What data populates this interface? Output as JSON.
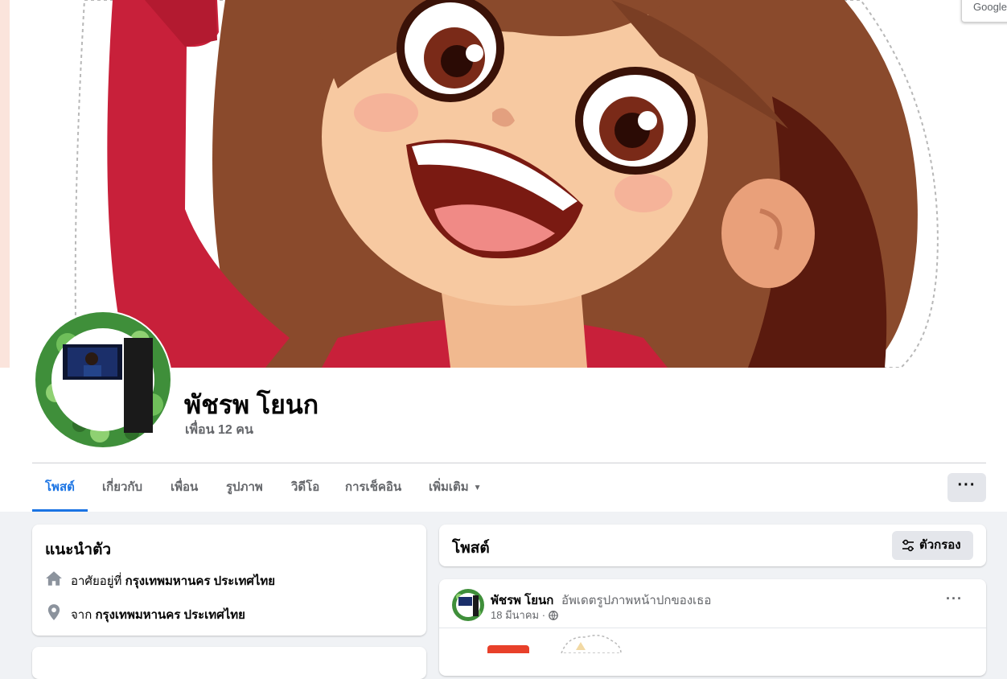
{
  "overlay": {
    "google_label": "Google"
  },
  "profile": {
    "name": "พัชรพ โยนก",
    "friends_text": "เพื่อน 12 คน"
  },
  "tabs": [
    {
      "label": "โพสต์",
      "active": true
    },
    {
      "label": "เกี่ยวกับ",
      "active": false
    },
    {
      "label": "เพื่อน",
      "active": false
    },
    {
      "label": "รูปภาพ",
      "active": false
    },
    {
      "label": "วิดีโอ",
      "active": false
    },
    {
      "label": "การเช็คอิน",
      "active": false
    },
    {
      "label": "เพิ่มเติม",
      "active": false
    }
  ],
  "more_options_label": "···",
  "intro": {
    "title": "แนะนำตัว",
    "lives_in": {
      "prefix": "อาศัยอยู่ที่",
      "place": "กรุงเทพมหานคร ประเทศไทย",
      "icon": "home-icon"
    },
    "from": {
      "prefix": "จาก",
      "place": "กรุงเทพมหานคร ประเทศไทย",
      "icon": "location-pin-icon"
    }
  },
  "posts": {
    "title": "โพสต์",
    "filter_label": "ตัวกรอง",
    "items": [
      {
        "author": "พัชรพ โยนก",
        "action": "อัพเดตรูปภาพหน้าปกของเธอ",
        "date": "18 มีนาคม",
        "separator": "·",
        "privacy_icon": "globe-icon",
        "menu_label": "···"
      }
    ]
  },
  "colors": {
    "accent": "#1b74e4",
    "secondary_text": "#65676b",
    "background": "#f0f2f5",
    "button_gray": "#e4e6eb"
  }
}
